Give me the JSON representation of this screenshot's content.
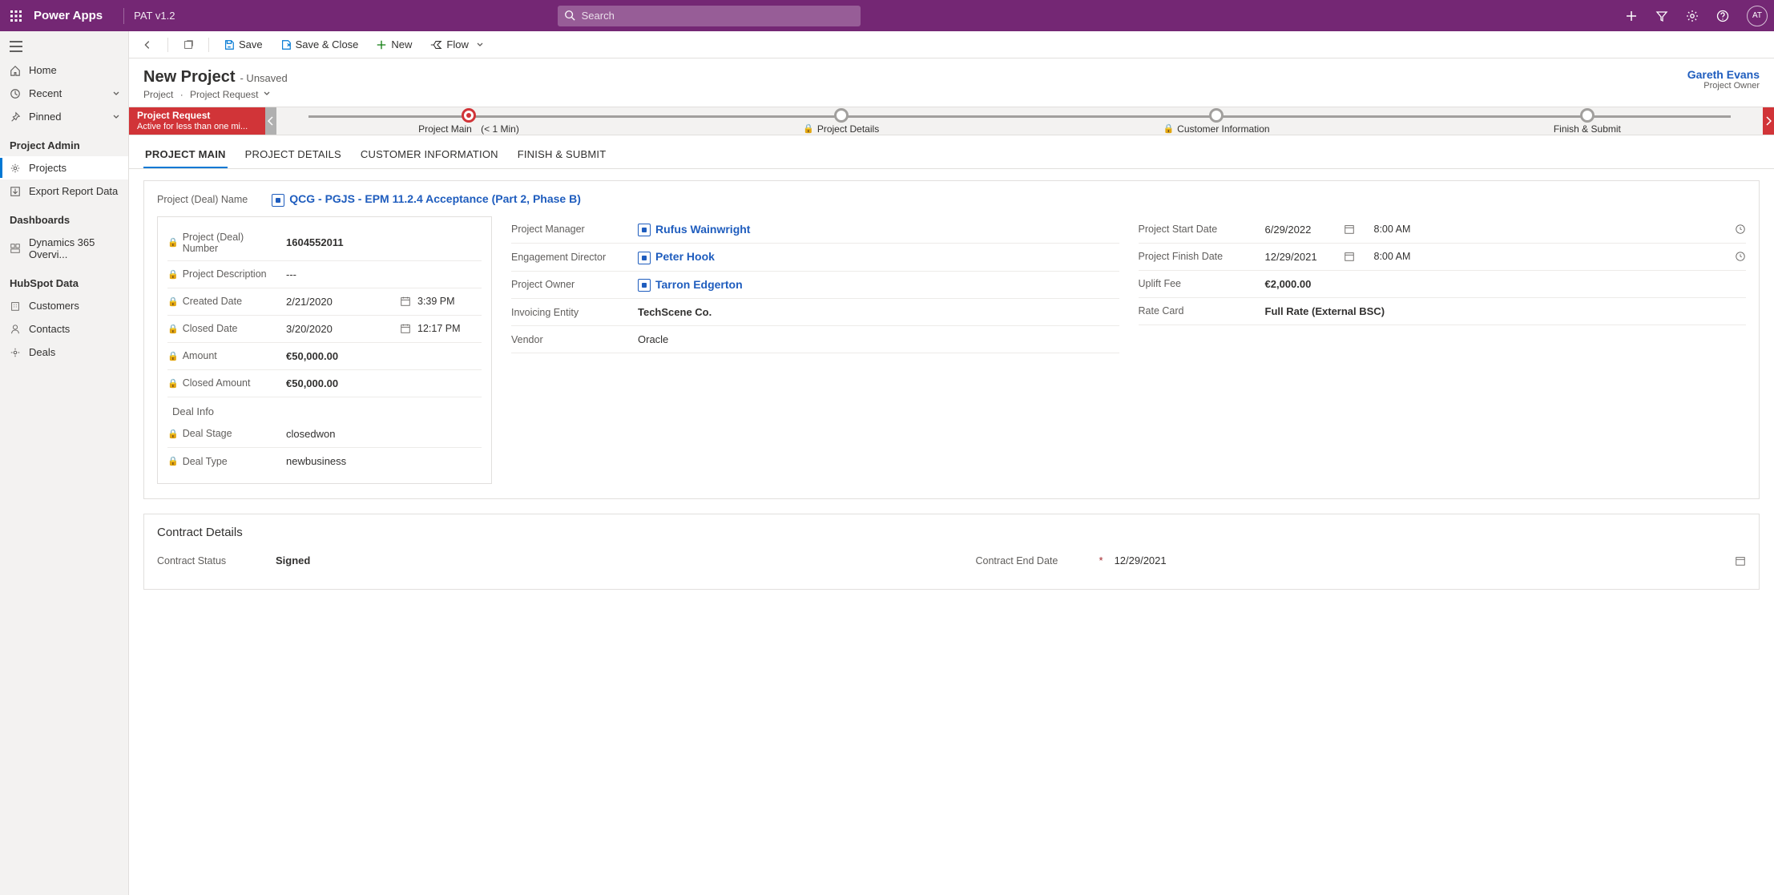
{
  "topbar": {
    "brand": "Power Apps",
    "app_version": "PAT v1.2",
    "search_placeholder": "Search",
    "avatar_initials": "AT"
  },
  "leftnav": {
    "home": "Home",
    "recent": "Recent",
    "pinned": "Pinned",
    "sec_admin": "Project Admin",
    "projects": "Projects",
    "export": "Export Report Data",
    "sec_dash": "Dashboards",
    "dyn365": "Dynamics 365 Overvi...",
    "sec_hub": "HubSpot Data",
    "customers": "Customers",
    "contacts": "Contacts",
    "deals": "Deals"
  },
  "toolbar": {
    "save": "Save",
    "save_close": "Save & Close",
    "new": "New",
    "flow": "Flow"
  },
  "header": {
    "title": "New Project",
    "status": "- Unsaved",
    "crumb1": "Project",
    "crumb2": "Project Request",
    "owner_name": "Gareth Evans",
    "owner_role": "Project Owner"
  },
  "bpf": {
    "flag_title": "Project Request",
    "flag_sub": "Active for less than one mi...",
    "s1": "Project Main",
    "s1_time": "(< 1 Min)",
    "s2": "Project Details",
    "s3": "Customer Information",
    "s4": "Finish & Submit"
  },
  "tabs": {
    "t1": "PROJECT MAIN",
    "t2": "PROJECT DETAILS",
    "t3": "CUSTOMER INFORMATION",
    "t4": "FINISH & SUBMIT"
  },
  "form": {
    "deal_name_label": "Project (Deal) Name",
    "deal_name_value": "QCG - PGJS - EPM 11.2.4 Acceptance (Part 2, Phase B)",
    "deal_number_label": "Project (Deal) Number",
    "deal_number_value": "1604552011",
    "desc_label": "Project Description",
    "desc_value": "---",
    "created_label": "Created Date",
    "created_date": "2/21/2020",
    "created_time": "3:39 PM",
    "closed_label": "Closed Date",
    "closed_date": "3/20/2020",
    "closed_time": "12:17 PM",
    "amount_label": "Amount",
    "amount_value": "€50,000.00",
    "closed_amount_label": "Closed Amount",
    "closed_amount_value": "€50,000.00",
    "deal_info_head": "Deal Info",
    "deal_stage_label": "Deal Stage",
    "deal_stage_value": "closedwon",
    "deal_type_label": "Deal Type",
    "deal_type_value": "newbusiness",
    "pm_label": "Project Manager",
    "pm_value": "Rufus Wainwright",
    "ed_label": "Engagement Director",
    "ed_value": "Peter Hook",
    "po_label": "Project Owner",
    "po_value": "Tarron Edgerton",
    "inv_label": "Invoicing Entity",
    "inv_value": "TechScene Co.",
    "vendor_label": "Vendor",
    "vendor_value": "Oracle",
    "start_label": "Project Start Date",
    "start_date": "6/29/2022",
    "start_time": "8:00 AM",
    "finish_label": "Project Finish Date",
    "finish_date": "12/29/2021",
    "finish_time": "8:00 AM",
    "uplift_label": "Uplift Fee",
    "uplift_value": "€2,000.00",
    "rate_label": "Rate Card",
    "rate_value": "Full Rate (External BSC)"
  },
  "contract": {
    "head": "Contract Details",
    "status_label": "Contract Status",
    "status_value": "Signed",
    "end_label": "Contract End Date",
    "end_value": "12/29/2021"
  }
}
